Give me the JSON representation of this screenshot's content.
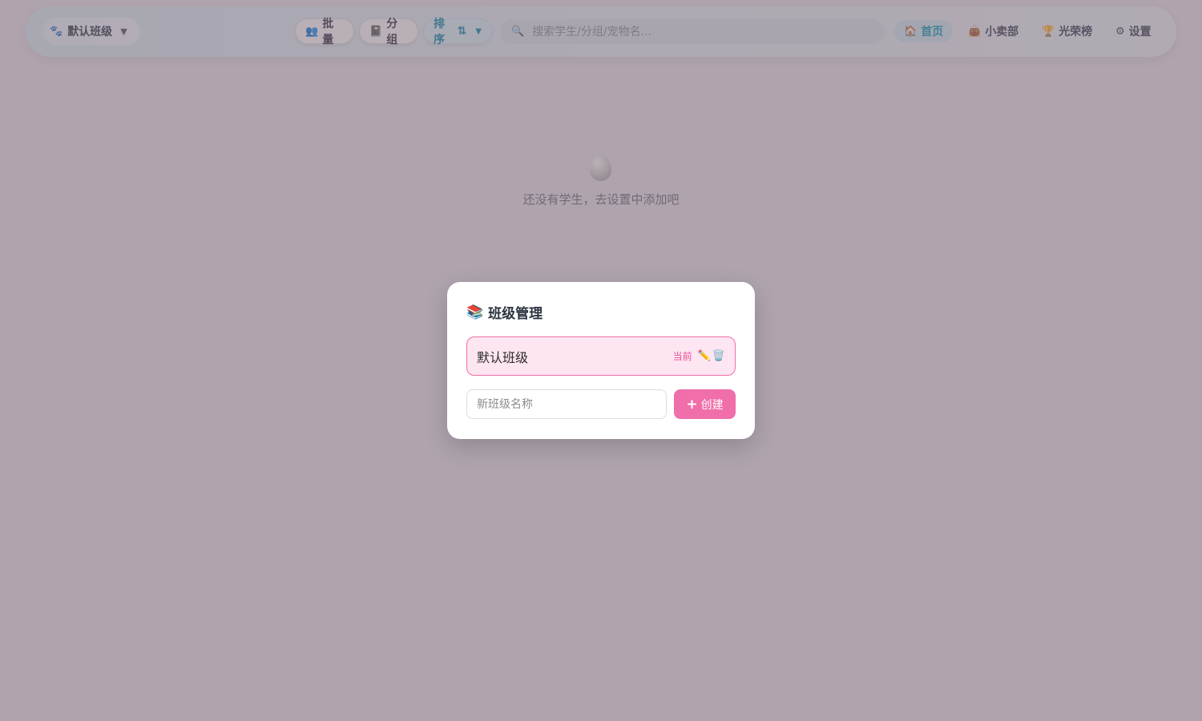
{
  "header": {
    "class_selector": {
      "icon": "paw-icon",
      "label": "默认班级"
    },
    "toolbar": {
      "batch": {
        "icon": "people-icon",
        "label": "批量"
      },
      "group": {
        "icon": "notebook-icon",
        "label": "分组"
      },
      "sort": {
        "label": "排序",
        "icon": "sort-arrows-icon"
      }
    },
    "search": {
      "placeholder": "搜索学生/分组/宠物名..."
    },
    "nav": [
      {
        "icon": "house-icon",
        "label": "首页",
        "active": true
      },
      {
        "icon": "shopping-bag-icon",
        "label": "小卖部",
        "active": false
      },
      {
        "icon": "trophy-icon",
        "label": "光荣榜",
        "active": false
      },
      {
        "icon": "gear-icon",
        "label": "设置",
        "active": false
      }
    ]
  },
  "empty_state": {
    "icon": "egg-icon",
    "text": "还没有学生，去设置中添加吧"
  },
  "modal": {
    "icon": "books-icon",
    "title": "班级管理",
    "classes": [
      {
        "name": "默认班级",
        "badge": "当前",
        "actions": [
          "pencil-icon",
          "trash-icon"
        ]
      }
    ],
    "new_class_placeholder": "新班级名称",
    "create_button": "创建"
  },
  "colors": {
    "accent_pink": "#f06ea9",
    "accent_teal": "#14a0b5",
    "overlay": "#786473"
  }
}
